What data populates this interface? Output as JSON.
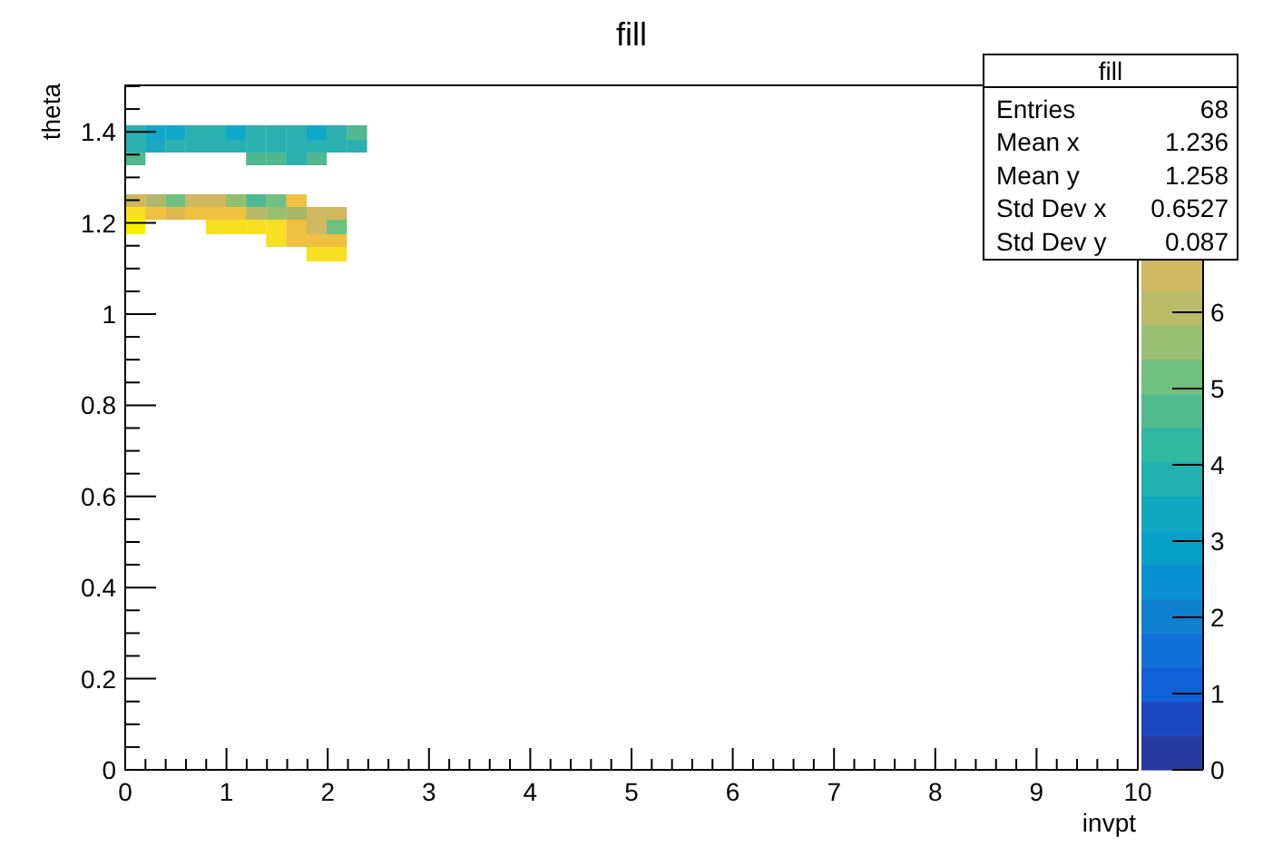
{
  "title": "fill",
  "x_axis": {
    "label": "invpt",
    "ticks": [
      "0",
      "1",
      "2",
      "3",
      "4",
      "5",
      "6",
      "7",
      "8",
      "9",
      "10"
    ]
  },
  "y_axis": {
    "label": "theta",
    "ticks": [
      "1.4",
      "1.2",
      "1",
      "0.8",
      "0.6",
      "0.4",
      "0.2",
      "0"
    ]
  },
  "color_scale": {
    "ticks": [
      "6",
      "5",
      "4",
      "3",
      "2",
      "1",
      "0"
    ]
  },
  "stats_box": {
    "title": "fill",
    "rows": [
      {
        "name": "Entries",
        "value": "68"
      },
      {
        "name": "Mean x",
        "value": "1.236"
      },
      {
        "name": "Mean y",
        "value": "1.258"
      },
      {
        "name": "Std Dev x",
        "value": "0.6527"
      },
      {
        "name": "Std Dev y",
        "value": "0.087"
      }
    ]
  }
}
